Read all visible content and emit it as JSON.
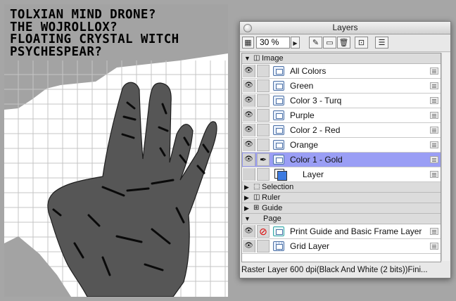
{
  "canvas": {
    "text_lines": [
      "TOLXIAN MIND DRONE?",
      "THE WOJROLLOX?",
      "FLOATING CRYSTAL WITCH",
      "PSYCHESPEAR?"
    ]
  },
  "palette": {
    "title": "Layers",
    "zoom": "30 %",
    "sections": {
      "image": "Image",
      "selection": "Selection",
      "ruler": "Ruler",
      "guide": "Guide",
      "page": "Page"
    },
    "image_layers": [
      {
        "name": "All Colors",
        "selected": false
      },
      {
        "name": "Green",
        "selected": false
      },
      {
        "name": "Color 3 - Turq",
        "selected": false
      },
      {
        "name": "Purple",
        "selected": false
      },
      {
        "name": "Color 2 - Red",
        "selected": false
      },
      {
        "name": "Orange",
        "selected": false
      },
      {
        "name": "Color 1 - Gold",
        "selected": true
      }
    ],
    "paper_layer": "Layer",
    "page_layers": [
      {
        "name": "Print Guide and Basic Frame Layer"
      },
      {
        "name": "Grid Layer"
      }
    ],
    "status": "Raster Layer 600 dpi(Black And White (2 bits))Fini..."
  },
  "colors": {
    "selected_row": "#9a9ef5",
    "hand": "#555555",
    "background_gray": "#a6a6a6",
    "gridline": "#bdbdbd"
  }
}
